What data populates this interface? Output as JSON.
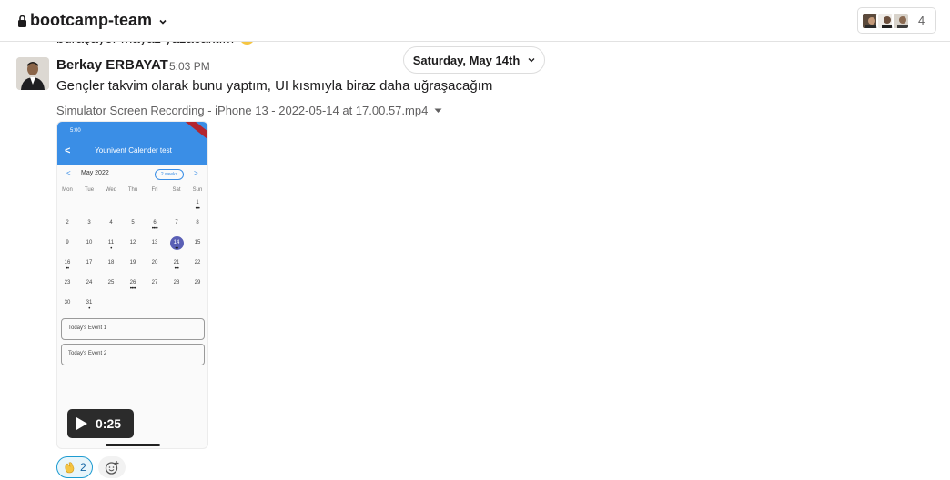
{
  "header": {
    "channel_name": "bootcamp-team",
    "member_count": "4",
    "icons": {
      "lock": "lock-icon",
      "chevron": "chevron-down-icon"
    }
  },
  "previous_message": {
    "text_fragment": "buraşayor mayaz yazacaktım"
  },
  "date_divider": {
    "label": "Saturday, May 14th"
  },
  "message": {
    "author": "Berkay ERBAYAT",
    "time": "5:03 PM",
    "text": "Gençler takvim olarak bunu yaptım, UI kısmıyla biraz daha uğraşacağım",
    "attachment_name": "Simulator Screen Recording - iPhone 13 - 2022-05-14 at 17.00.57.mp4",
    "video": {
      "duration": "0:25",
      "screen": {
        "status_time": "5:00",
        "title": "Younivent Calender test",
        "month": "May 2022",
        "view_toggle": "2 weeks",
        "weekdays": [
          "Mon",
          "Tue",
          "Wed",
          "Thu",
          "Fri",
          "Sat",
          "Sun"
        ],
        "weeks": [
          [
            "",
            "",
            "",
            "",
            "",
            "",
            "1"
          ],
          [
            "2",
            "3",
            "4",
            "5",
            "6",
            "7",
            "8"
          ],
          [
            "9",
            "10",
            "11",
            "12",
            "13",
            "14",
            "15"
          ],
          [
            "16",
            "17",
            "18",
            "19",
            "20",
            "21",
            "22"
          ],
          [
            "23",
            "24",
            "25",
            "26",
            "27",
            "28",
            "29"
          ],
          [
            "30",
            "31",
            "",
            "",
            "",
            "",
            ""
          ]
        ],
        "selected_day": "14",
        "events": [
          "Today's Event 1",
          "Today's Event 2"
        ]
      }
    }
  },
  "reactions": [
    {
      "emoji": "clapping-hands",
      "count": "2"
    }
  ],
  "colors": {
    "accent": "#1264a3",
    "app_bar": "#3a8ee6",
    "selected_day": "#5a5fb5"
  }
}
